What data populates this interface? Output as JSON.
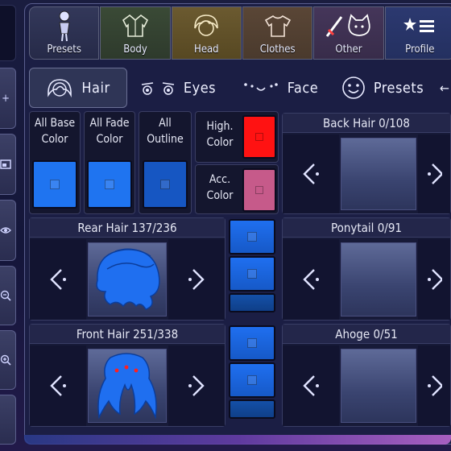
{
  "categories": [
    {
      "label": "Presets",
      "icon": "figure-icon"
    },
    {
      "label": "Body",
      "icon": "jacket-icon"
    },
    {
      "label": "Head",
      "icon": "hair-head-icon"
    },
    {
      "label": "Clothes",
      "icon": "tshirt-icon"
    },
    {
      "label": "Other",
      "icon": "sword-cat-icon"
    },
    {
      "label": "Profile",
      "icon": "star-list-icon"
    }
  ],
  "subtabs": [
    {
      "label": "Hair",
      "icon": "hair-icon",
      "active": true
    },
    {
      "label": "Eyes",
      "icon": "eyes-icon",
      "active": false
    },
    {
      "label": "Face",
      "icon": "face-icon",
      "active": false
    },
    {
      "label": "Presets",
      "icon": "smiley-icon",
      "active": false
    }
  ],
  "color_controls": {
    "all_base": {
      "label": "All Base\nColor",
      "color": "#1f74f0"
    },
    "all_fade": {
      "label": "All Fade\nColor",
      "color": "#1f74f0"
    },
    "all_outline": {
      "label": "All\nOutline",
      "color": "#1656c2"
    },
    "high_color": {
      "label": "High.\nColor",
      "color": "#ff1212"
    },
    "acc_color": {
      "label": "Acc.\nColor",
      "color": "#c65a8a"
    }
  },
  "parts": {
    "back_hair": {
      "title": "Back Hair 0/108"
    },
    "rear_hair": {
      "title": "Rear Hair 137/236"
    },
    "ponytail": {
      "title": "Ponytail 0/91"
    },
    "front_hair": {
      "title": "Front Hair 251/338"
    },
    "ahoge": {
      "title": "Ahoge 0/51"
    }
  },
  "colors": {
    "hair_blue": "#1f6ff0",
    "accent_red": "#ff1212"
  }
}
